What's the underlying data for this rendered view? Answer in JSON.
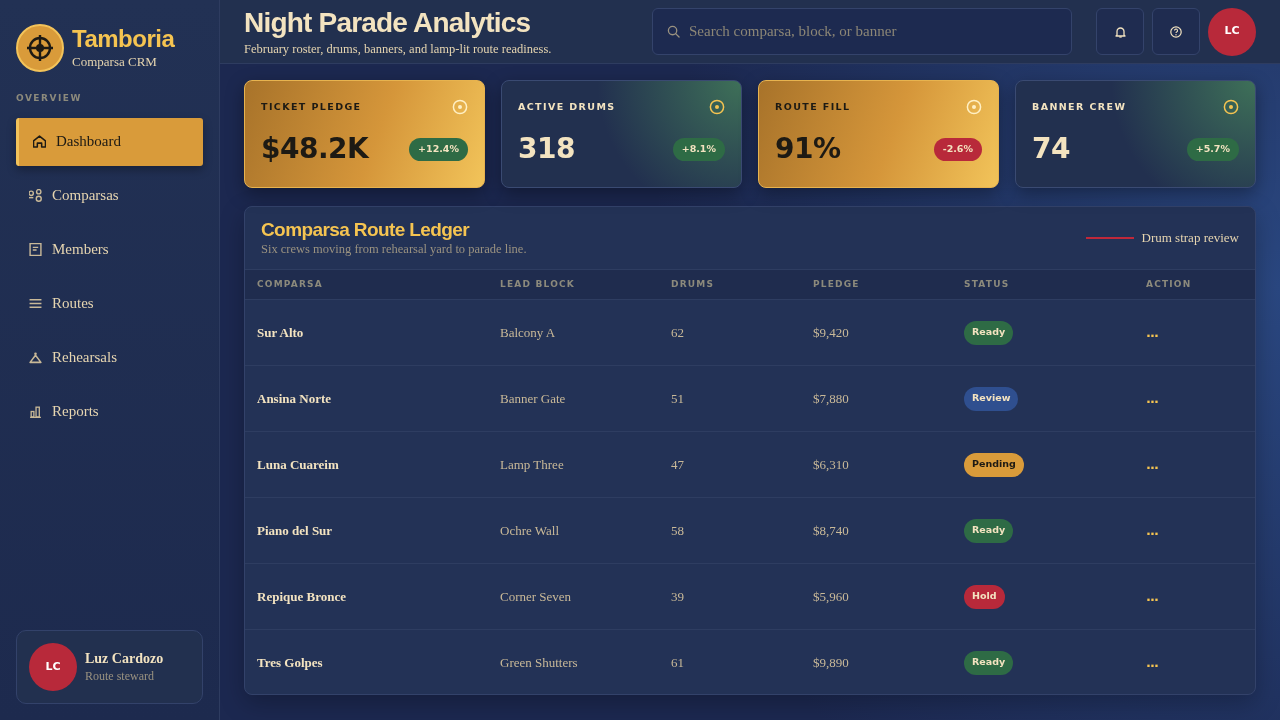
{
  "sidebar": {
    "brand": {
      "name": "Tamboria",
      "subtitle": "Comparsa CRM"
    },
    "section_label": "OVERVIEW",
    "items": [
      {
        "label": "Dashboard",
        "selected": true
      },
      {
        "label": "Comparsas",
        "selected": false
      },
      {
        "label": "Members",
        "selected": false
      },
      {
        "label": "Routes",
        "selected": false
      },
      {
        "label": "Rehearsals",
        "selected": false
      },
      {
        "label": "Reports",
        "selected": false
      }
    ],
    "user": {
      "initials": "LC",
      "name": "Luz Cardozo",
      "role": "Route steward"
    }
  },
  "header": {
    "title": "Night Parade Analytics",
    "subtitle": "February roster, drums, banners, and lamp-lit route readiness.",
    "search": {
      "placeholder": "Search comparsa, block, or banner"
    },
    "avatar_initials": "LC"
  },
  "kpis": [
    {
      "label": "TICKET PLEDGE",
      "value": "$48.2K",
      "delta": {
        "text": "+12.4%",
        "color": "#2e6b45"
      },
      "highlight": true
    },
    {
      "label": "ACTIVE DRUMS",
      "value": "318",
      "delta": {
        "text": "+8.1%",
        "color": "#2e6b45"
      },
      "highlight": false
    },
    {
      "label": "ROUTE FILL",
      "value": "91%",
      "delta": {
        "text": "-2.6%",
        "color": "#b8293a"
      },
      "highlight": true
    },
    {
      "label": "BANNER CREW",
      "value": "74",
      "delta": {
        "text": "+5.7%",
        "color": "#2e6b45"
      },
      "highlight": false
    }
  ],
  "ledger": {
    "title": "Comparsa Route Ledger",
    "subtitle": "Six crews moving from rehearsal yard to parade line.",
    "legend": "Drum strap review",
    "columns": [
      "COMPARSA",
      "LEAD BLOCK",
      "DRUMS",
      "PLEDGE",
      "STATUS",
      "ACTION"
    ],
    "rows": [
      {
        "comparsa": "Sur Alto",
        "lead_block": "Balcony A",
        "drums": "62",
        "pledge": "$9,420",
        "status": {
          "label": "Ready",
          "color": "#2e6b45"
        },
        "action": "..."
      },
      {
        "comparsa": "Ansina Norte",
        "lead_block": "Banner Gate",
        "drums": "51",
        "pledge": "$7,880",
        "status": {
          "label": "Review",
          "color": "#2f4f8f"
        },
        "action": "..."
      },
      {
        "comparsa": "Luna Cuareim",
        "lead_block": "Lamp Three",
        "drums": "47",
        "pledge": "$6,310",
        "status": {
          "label": "Pending",
          "color": "#d99b3a"
        },
        "action": "..."
      },
      {
        "comparsa": "Piano del Sur",
        "lead_block": "Ochre Wall",
        "drums": "58",
        "pledge": "$8,740",
        "status": {
          "label": "Ready",
          "color": "#2e6b45"
        },
        "action": "..."
      },
      {
        "comparsa": "Repique Bronce",
        "lead_block": "Corner Seven",
        "drums": "39",
        "pledge": "$5,960",
        "status": {
          "label": "Hold",
          "color": "#b8293a"
        },
        "action": "..."
      },
      {
        "comparsa": "Tres Golpes",
        "lead_block": "Green Shutters",
        "drums": "61",
        "pledge": "$9,890",
        "status": {
          "label": "Ready",
          "color": "#2e6b45"
        },
        "action": "..."
      }
    ]
  }
}
